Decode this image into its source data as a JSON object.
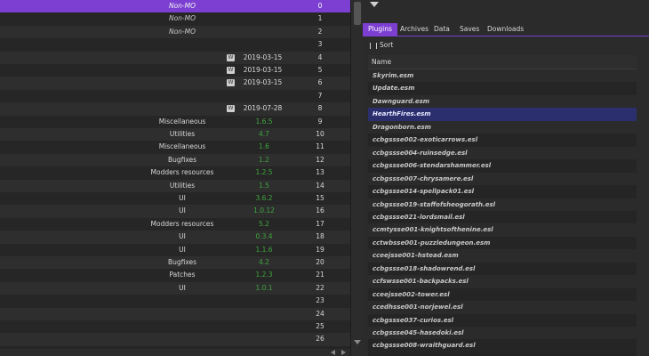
{
  "mods": [
    {
      "category": "Non-MO",
      "priority": "0",
      "selected": true,
      "italic": true
    },
    {
      "category": "Non-MO",
      "priority": "1",
      "italic": true
    },
    {
      "category": "Non-MO",
      "priority": "2",
      "italic": true
    },
    {
      "priority": "3"
    },
    {
      "flag": "W",
      "date": "2019-03-15",
      "priority": "4"
    },
    {
      "flag": "W",
      "date": "2019-03-15",
      "priority": "5"
    },
    {
      "flag": "W",
      "date": "2019-03-15",
      "priority": "6"
    },
    {
      "priority": "7"
    },
    {
      "flag": "W",
      "date": "2019-07-28",
      "priority": "8"
    },
    {
      "category": "Miscellaneous",
      "version": "1.6.5",
      "priority": "9"
    },
    {
      "category": "Utilities",
      "version": "4.7",
      "priority": "10"
    },
    {
      "category": "Miscellaneous",
      "version": "1.6",
      "priority": "11"
    },
    {
      "category": "Bugfixes",
      "version": "1.2",
      "priority": "12"
    },
    {
      "category": "Modders resources",
      "version": "1.2.5",
      "priority": "13"
    },
    {
      "category": "Utilities",
      "version": "1.5",
      "priority": "14"
    },
    {
      "category": "UI",
      "version": "3.6.2",
      "priority": "15"
    },
    {
      "category": "UI",
      "version": "1.0.12",
      "priority": "16"
    },
    {
      "category": "Modders resources",
      "version": "5.2",
      "priority": "17"
    },
    {
      "category": "UI",
      "version": "0.3.4",
      "priority": "18"
    },
    {
      "category": "UI",
      "version": "1.1.6",
      "priority": "19"
    },
    {
      "category": "Bugfixes",
      "version": "4.2",
      "priority": "20"
    },
    {
      "category": "Patches",
      "version": "1.2.3",
      "priority": "21"
    },
    {
      "category": "UI",
      "version": "1.0.1",
      "priority": "22"
    },
    {
      "priority": "23"
    },
    {
      "priority": "24"
    },
    {
      "priority": "25"
    },
    {
      "priority": "26"
    }
  ],
  "tabs": [
    "Plugins",
    "Archives",
    "Data",
    "Saves",
    "Downloads"
  ],
  "active_tab": 0,
  "sort_label": "Sort",
  "plugin_header": "Name",
  "plugins": [
    "Skyrim.esm",
    "Update.esm",
    "Dawnguard.esm",
    "HearthFires.esm",
    "Dragonborn.esm",
    "ccbgssse002-exoticarrows.esl",
    "ccbgssse004-ruinsedge.esl",
    "ccbgssse006-stendarshammer.esl",
    "ccbgssse007-chrysamere.esl",
    "ccbgssse014-spellpack01.esl",
    "ccbgssse019-staffofsheogorath.esl",
    "ccbgssse021-lordsmail.esl",
    "ccmtysse001-knightsofthenine.esl",
    "cctwbsse001-puzzledungeon.esm",
    "cceejsse001-hstead.esm",
    "ccbgssse018-shadowrend.esl",
    "ccfswsse001-backpacks.esl",
    "cceejsse002-tower.esl",
    "ccedhsse001-norjewel.esl",
    "ccbgssse037-curios.esl",
    "ccbgssse045-hasedoki.esl",
    "ccbgssse008-wraithguard.esl"
  ],
  "selected_plugin": 3,
  "colors": {
    "accent": "#7c3fd1",
    "version_green": "#3fa63f",
    "plugin_selected": "#2b2f6e"
  }
}
